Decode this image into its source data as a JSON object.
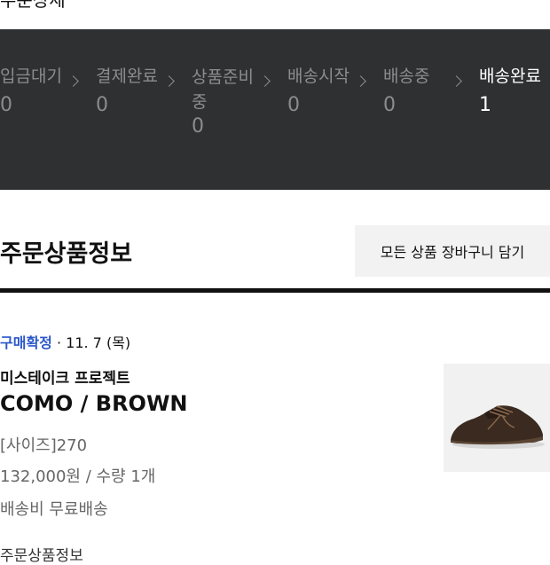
{
  "header": {
    "partial_title": "주문상세"
  },
  "status_steps": [
    {
      "label": "입금대기",
      "count": "0",
      "active": false
    },
    {
      "label": "결제완료",
      "count": "0",
      "active": false
    },
    {
      "label": "상품준비\n중",
      "count": "0",
      "active": false
    },
    {
      "label": "배송시작",
      "count": "0",
      "active": false
    },
    {
      "label": "배송중",
      "count": "0",
      "active": false
    },
    {
      "label": "배송완료",
      "count": "1",
      "active": true
    }
  ],
  "section": {
    "title": "주문상품정보"
  },
  "actions": {
    "cart_all_label": "모든 상품 장바구니 담기"
  },
  "order": {
    "status": "구매확정",
    "date": " · 11. 7 (목)",
    "brand": "미스테이크 프로젝트",
    "product_name": "COMO / BROWN",
    "option": "[사이즈]270",
    "price_qty": "132,000원 / 수량 1개",
    "shipping": "배송비 무료배송",
    "image_icon": "brown-suede-shoe"
  },
  "footer": {
    "partial_text": "주문상품정보"
  },
  "colors": {
    "panel_bg": "#2f3032",
    "inactive_step": "#8b8c8e",
    "active_step": "#ffffff",
    "status_link": "#2b57c8"
  }
}
